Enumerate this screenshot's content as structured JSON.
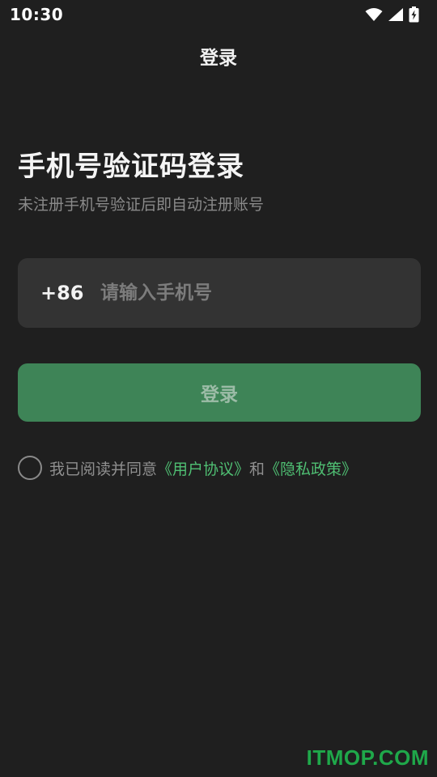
{
  "status_bar": {
    "time": "10:30",
    "icons": [
      "wifi-icon",
      "signal-icon",
      "battery-charging-icon"
    ]
  },
  "header": {
    "title": "登录"
  },
  "main": {
    "heading": "手机号验证码登录",
    "subheading": "未注册手机号验证后即自动注册账号",
    "phone": {
      "country_code": "+86",
      "value": "",
      "placeholder": "请输入手机号"
    },
    "login_button": {
      "label": "登录"
    },
    "agreement": {
      "checked": false,
      "prefix": "我已阅读并同意",
      "user_agreement": "《用户协议》",
      "conjunction": "和",
      "privacy_policy": "《隐私政策》"
    }
  },
  "watermark": "ITMOP.COM",
  "colors": {
    "background": "#1f1f1f",
    "input_background": "#333333",
    "button_background": "#3e8457",
    "link": "#4fbf73",
    "watermark": "#1fa84a"
  }
}
